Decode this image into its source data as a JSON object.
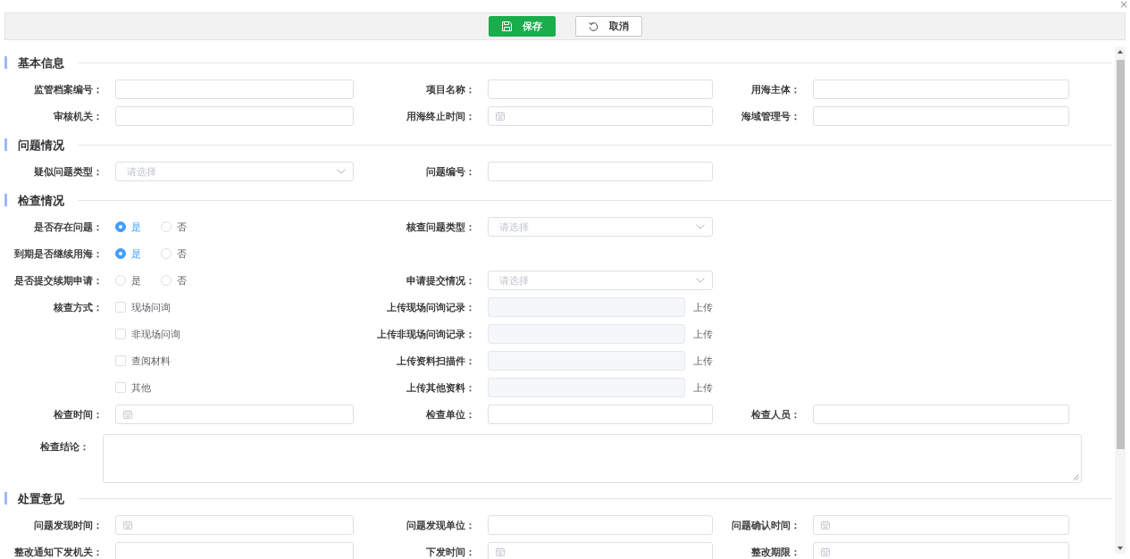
{
  "dialog": {
    "close": "×"
  },
  "toolbar": {
    "buttons": [
      {
        "kind": "save",
        "label": "保存"
      },
      {
        "kind": "cancel",
        "label": "取消"
      }
    ]
  },
  "sections": [
    {
      "title": "基本信息",
      "rows": [
        {
          "cells": [
            {
              "kind": "text",
              "label": "监管档案编号："
            },
            {
              "kind": "text",
              "label": "项目名称："
            },
            {
              "kind": "text",
              "label": "用海主体："
            }
          ]
        },
        {
          "cells": [
            {
              "kind": "text",
              "label": "审核机关："
            },
            {
              "kind": "date",
              "label": "用海终止时间："
            },
            {
              "kind": "text",
              "label": "海域管理号："
            }
          ]
        }
      ]
    },
    {
      "title": "问题情况",
      "rows": [
        {
          "cells": [
            {
              "kind": "select",
              "label": "疑似问题类型：",
              "placeholder": "请选择"
            },
            {
              "kind": "text",
              "label": "问题编号："
            }
          ]
        }
      ]
    },
    {
      "title": "检查情况",
      "rows": [
        {
          "cells": [
            {
              "kind": "radio",
              "label": "是否存在问题：",
              "options": [
                {
                  "label": "是",
                  "selected": true
                },
                {
                  "label": "否",
                  "selected": false
                }
              ]
            },
            {
              "kind": "select",
              "label": "核查问题类型：",
              "placeholder": "请选择"
            }
          ]
        },
        {
          "cells": [
            {
              "kind": "radio",
              "label": "到期是否继续用海：",
              "options": [
                {
                  "label": "是",
                  "selected": true
                },
                {
                  "label": "否",
                  "selected": false
                }
              ]
            }
          ]
        },
        {
          "cells": [
            {
              "kind": "radio",
              "label": "是否提交续期申请：",
              "options": [
                {
                  "label": "是",
                  "selected": false
                },
                {
                  "label": "否",
                  "selected": false
                }
              ]
            },
            {
              "kind": "select",
              "label": "申请提交情况：",
              "placeholder": "请选择"
            }
          ]
        },
        {
          "cells": [
            {
              "kind": "checkbox",
              "label": "核查方式：",
              "option": "现场问询",
              "checked": false
            },
            {
              "kind": "upload",
              "label": "上传现场问询记录：",
              "disabled": true,
              "action": "上传"
            }
          ]
        },
        {
          "cells": [
            {
              "kind": "checkbox",
              "option": "非现场问询",
              "checked": false
            },
            {
              "kind": "upload",
              "label": "上传非现场问询记录：",
              "disabled": true,
              "action": "上传"
            }
          ]
        },
        {
          "cells": [
            {
              "kind": "checkbox",
              "option": "查阅材料",
              "checked": false
            },
            {
              "kind": "upload",
              "label": "上传资料扫描件：",
              "disabled": true,
              "action": "上传"
            }
          ]
        },
        {
          "cells": [
            {
              "kind": "checkbox",
              "option": "其他",
              "checked": false
            },
            {
              "kind": "upload",
              "label": "上传其他资料：",
              "disabled": true,
              "action": "上传"
            }
          ]
        },
        {
          "cells": [
            {
              "kind": "date",
              "label": "检查时间："
            },
            {
              "kind": "text",
              "label": "检查单位："
            },
            {
              "kind": "text",
              "label": "检查人员："
            }
          ]
        },
        {
          "cells": [
            {
              "kind": "textarea",
              "label": "检查结论："
            }
          ]
        }
      ]
    },
    {
      "title": "处置意见",
      "rows": [
        {
          "cells": [
            {
              "kind": "date",
              "label": "问题发现时间："
            },
            {
              "kind": "text",
              "label": "问题发现单位："
            },
            {
              "kind": "date",
              "label": "问题确认时间："
            }
          ]
        },
        {
          "cells": [
            {
              "kind": "text",
              "label": "整改通知下发机关："
            },
            {
              "kind": "date",
              "label": "下发时间："
            },
            {
              "kind": "date",
              "label": "整改期限："
            }
          ]
        }
      ]
    }
  ]
}
